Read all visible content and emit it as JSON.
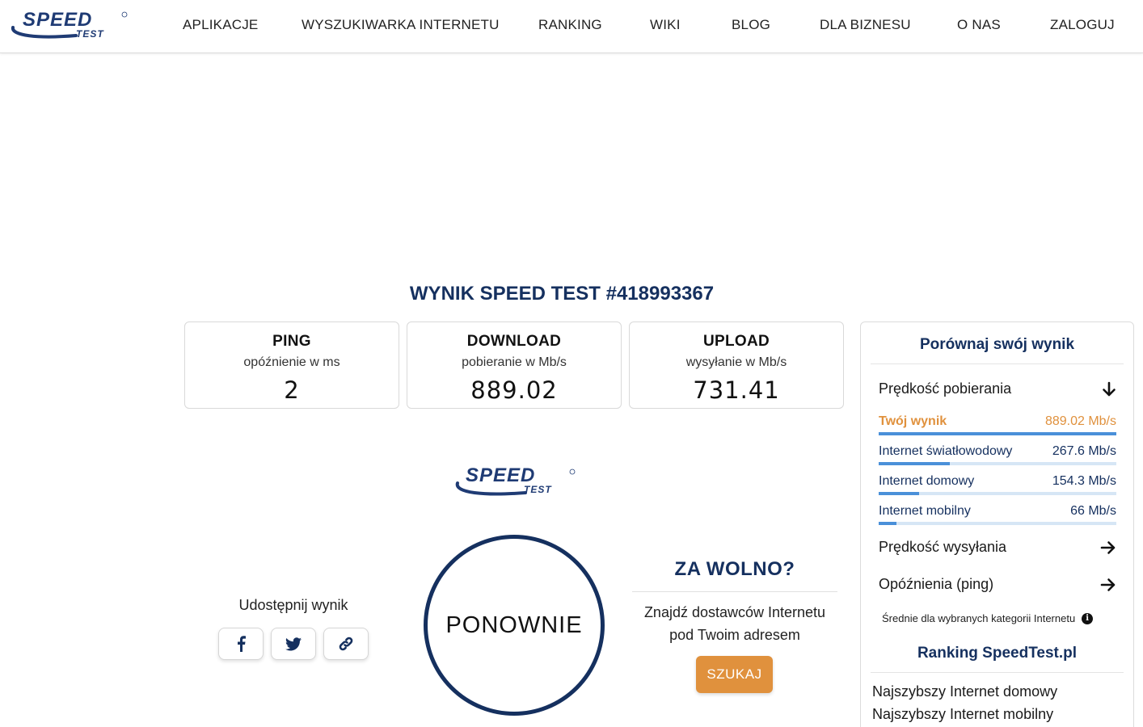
{
  "header": {
    "logo_text": "SPEED TEST",
    "nav": [
      {
        "label": "APLIKACJE"
      },
      {
        "label": "WYSZUKIWARKA INTERNETU"
      },
      {
        "label": "RANKING"
      },
      {
        "label": "WIKI"
      },
      {
        "label": "BLOG"
      },
      {
        "label": "DLA BIZNESU"
      },
      {
        "label": "O NAS"
      },
      {
        "label": "ZALOGUJ"
      }
    ]
  },
  "result": {
    "title": "WYNIK SPEED TEST #418993367",
    "cards": [
      {
        "title": "PING",
        "subtitle": "opóźnienie w ms",
        "value": "2"
      },
      {
        "title": "DOWNLOAD",
        "subtitle": "pobieranie w Mb/s",
        "value": "889.02"
      },
      {
        "title": "UPLOAD",
        "subtitle": "wysyłanie w Mb/s",
        "value": "731.41"
      }
    ]
  },
  "share": {
    "label": "Udostępnij wynik",
    "buttons": [
      {
        "icon": "facebook-icon"
      },
      {
        "icon": "twitter-icon"
      },
      {
        "icon": "link-icon"
      }
    ]
  },
  "restart_label": "PONOWNIE",
  "too_slow": {
    "title": "ZA WOLNO?",
    "text_line1": "Znajdź dostawców Internetu",
    "text_line2": "pod Twoim adresem",
    "button": "SZUKAJ"
  },
  "compare": {
    "title": "Porównaj swój wynik",
    "download_section": "Prędkość pobierania",
    "bars": [
      {
        "label": "Twój wynik",
        "value": "889.02 Mb/s",
        "fraction": 1.0,
        "mine": true
      },
      {
        "label": "Internet światłowodowy",
        "value": "267.6 Mb/s",
        "fraction": 0.3
      },
      {
        "label": "Internet domowy",
        "value": "154.3 Mb/s",
        "fraction": 0.17
      },
      {
        "label": "Internet mobilny",
        "value": "66 Mb/s",
        "fraction": 0.075
      }
    ],
    "upload_section": "Prędkość wysyłania",
    "ping_section": "Opóźnienia (ping)",
    "note": "Średnie dla wybranych kategorii Internetu",
    "ranking_title": "Ranking SpeedTest.pl",
    "ranking_links": [
      "Najszybszy Internet domowy",
      "Najszybszy Internet mobilny"
    ]
  },
  "colors": {
    "brand": "#15305f",
    "accent": "#e0913d",
    "bar": "#4a90d9"
  }
}
